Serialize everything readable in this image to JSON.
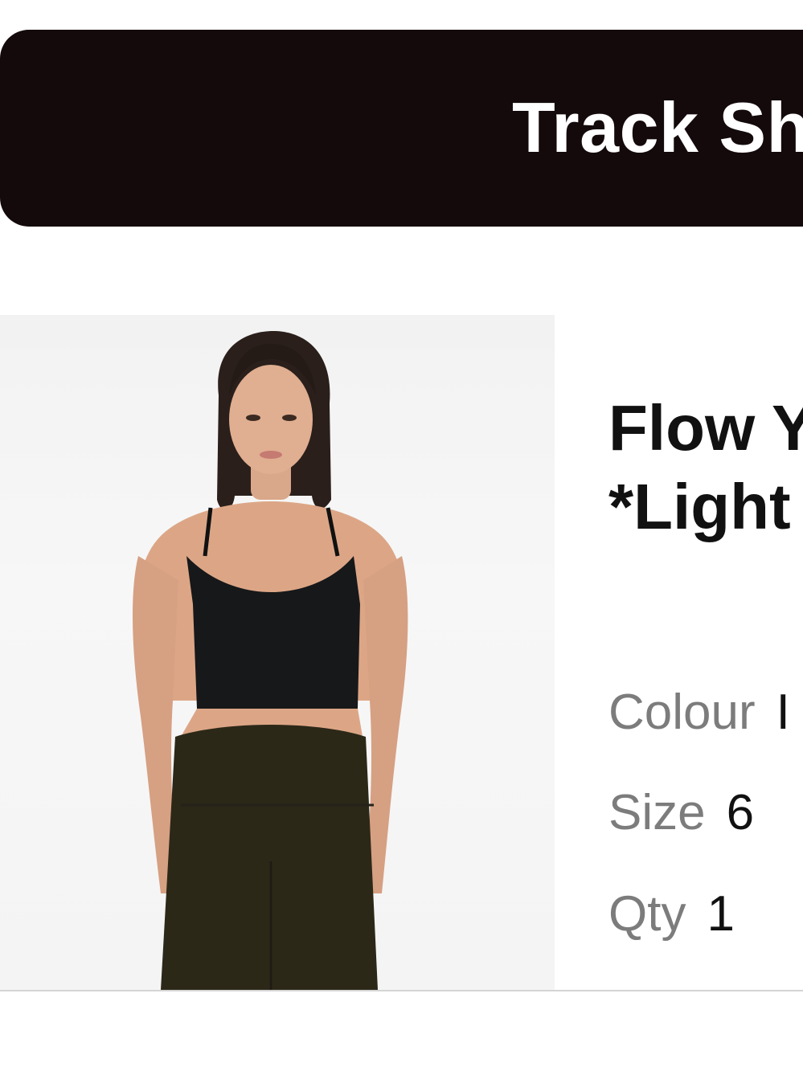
{
  "track_button": {
    "label": "Track Sh"
  },
  "product": {
    "title_line1": "Flow Y",
    "title_line2": "*Light",
    "image_icon": "model-photo",
    "attributes": {
      "colour_label": "Colour",
      "colour_value": "I",
      "size_label": "Size",
      "size_value": "6",
      "qty_label": "Qty",
      "qty_value": "1"
    }
  },
  "colors": {
    "button_bg": "#140a0b",
    "label_grey": "#7c7c7c"
  }
}
